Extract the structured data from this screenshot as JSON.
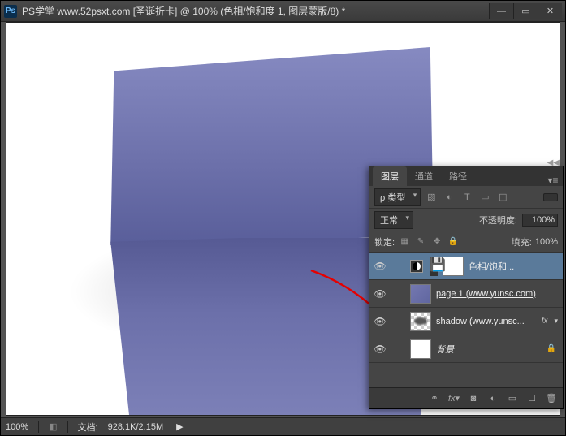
{
  "titlebar": {
    "app_icon": "Ps",
    "title": "PS学堂  www.52psxt.com [圣诞折卡] @ 100% (色相/饱和度 1, 图层蒙版/8) *"
  },
  "statusbar": {
    "zoom": "100%",
    "doc_label": "文档:",
    "doc_info": "928.1K/2.15M",
    "expand": "▶"
  },
  "layers_panel": {
    "tabs": [
      "图层",
      "通道",
      "路径"
    ],
    "active_tab": 0,
    "filter": {
      "kind": "ρ 类型"
    },
    "blend": {
      "mode": "正常",
      "opacity_label": "不透明度:",
      "opacity": "100%",
      "fill_label": "填充:",
      "fill": "100%"
    },
    "lock": {
      "label": "锁定:"
    },
    "layers": [
      {
        "name": "色相/饱和...",
        "type": "adjustment",
        "visible": true,
        "selected": true
      },
      {
        "name": "page 1 (www.yunsc.com)",
        "type": "image-card",
        "visible": true,
        "underlined": true
      },
      {
        "name": "shadow (www.yunsc...",
        "type": "image-shadow",
        "visible": true,
        "fx": true
      },
      {
        "name": "背景",
        "type": "bg",
        "visible": true,
        "locked": true
      }
    ]
  }
}
